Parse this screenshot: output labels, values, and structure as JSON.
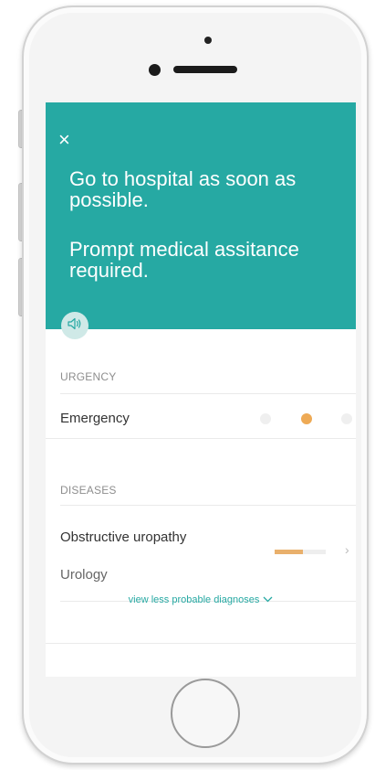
{
  "header": {
    "close_icon": "×",
    "message_line_1": "Go to hospital as soon as possible.",
    "message_line_2": "Prompt medical assitance required.",
    "audio_icon": "speaker-icon"
  },
  "urgency": {
    "section_label": "URGENCY",
    "level": "Emergency",
    "active_index": 1,
    "total": 3
  },
  "diseases": {
    "section_label": "DISEASES",
    "items": [
      {
        "name": "Obstructive uropathy",
        "category": "Urology",
        "probability": 0.55
      }
    ]
  },
  "more_link": {
    "label": "view less probable diagnoses"
  },
  "colors": {
    "accent": "#26a9a3",
    "urgency_active": "#eeaa55",
    "probability": "#e9b06c"
  }
}
